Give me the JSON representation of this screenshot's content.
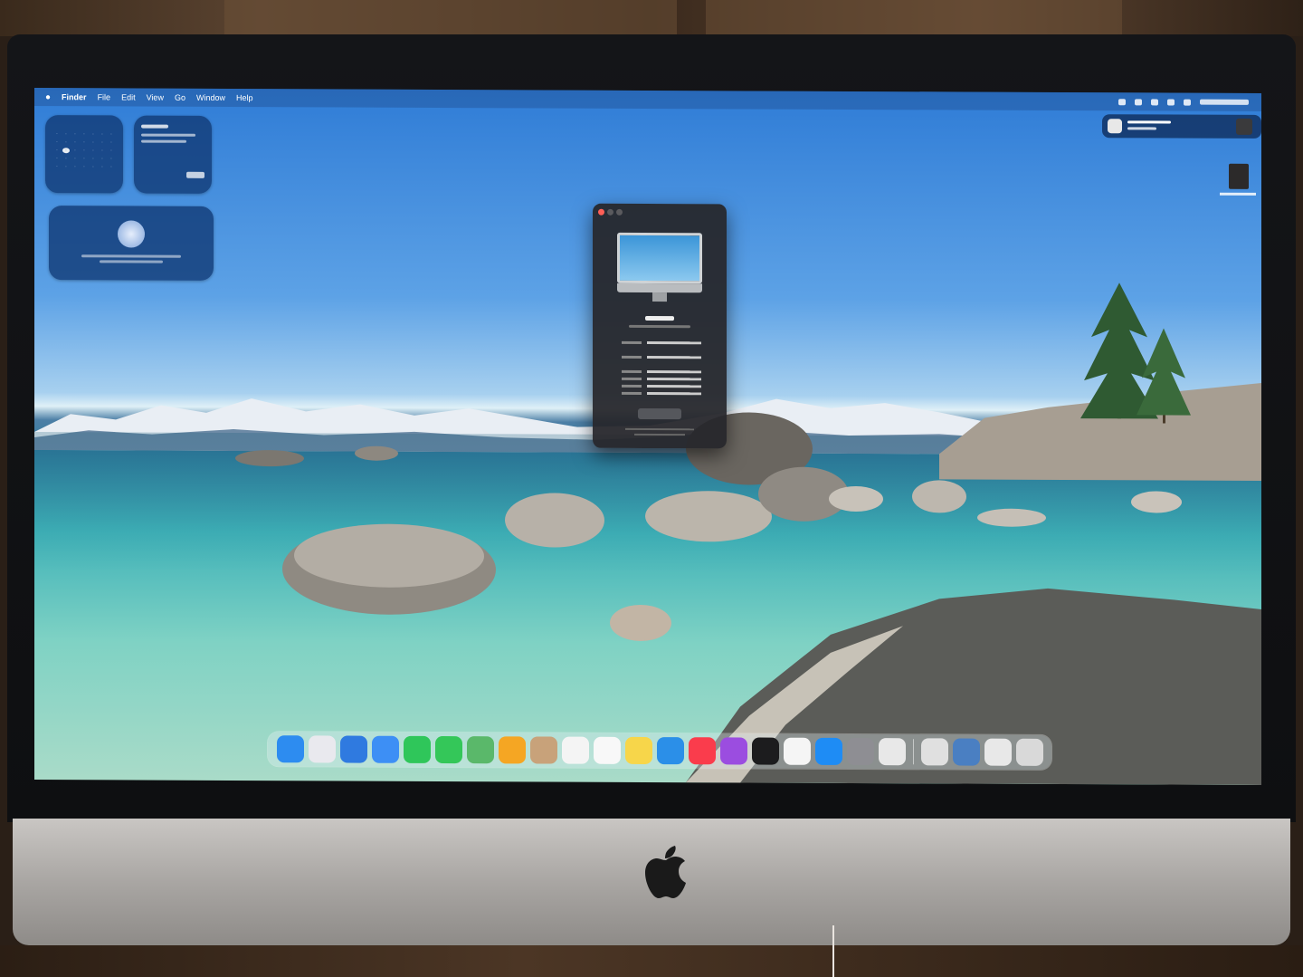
{
  "menubar": {
    "items": [
      "Finder",
      "File",
      "Edit",
      "View",
      "Go",
      "Window",
      "Help"
    ]
  },
  "dock": {
    "apps": [
      {
        "name": "finder-icon",
        "color": "#2d8cf0"
      },
      {
        "name": "launchpad-icon",
        "color": "#e9e9ee"
      },
      {
        "name": "safari-icon",
        "color": "#2f7ae0"
      },
      {
        "name": "mail-icon",
        "color": "#3d8ff5"
      },
      {
        "name": "facetime-icon",
        "color": "#2fc65a"
      },
      {
        "name": "messages-icon",
        "color": "#34c759"
      },
      {
        "name": "maps-icon",
        "color": "#5ab86a"
      },
      {
        "name": "photos-icon",
        "color": "#f5a623"
      },
      {
        "name": "contacts-icon",
        "color": "#c8a27a"
      },
      {
        "name": "calendar-icon",
        "color": "#f4f4f4"
      },
      {
        "name": "reminders-icon",
        "color": "#f8f8f8"
      },
      {
        "name": "notes-icon",
        "color": "#f7d64a"
      },
      {
        "name": "freeform-icon",
        "color": "#2b8fe8"
      },
      {
        "name": "music-icon",
        "color": "#fa3c4c"
      },
      {
        "name": "podcasts-icon",
        "color": "#9b4de0"
      },
      {
        "name": "apple-tv-icon",
        "color": "#1c1c1e"
      },
      {
        "name": "news-icon",
        "color": "#f5f5f5"
      },
      {
        "name": "app-store-icon",
        "color": "#1e8cf5"
      },
      {
        "name": "system-settings-icon",
        "color": "#8e8e93"
      },
      {
        "name": "chrome-icon",
        "color": "#e8e8e8"
      },
      {
        "name": "preview-icon",
        "color": "#e0e0e0"
      },
      {
        "name": "migration-icon",
        "color": "#4a7fc2"
      },
      {
        "name": "documents-folder-icon",
        "color": "#e8e8e8"
      },
      {
        "name": "trash-icon",
        "color": "#d9d9d9"
      }
    ]
  }
}
